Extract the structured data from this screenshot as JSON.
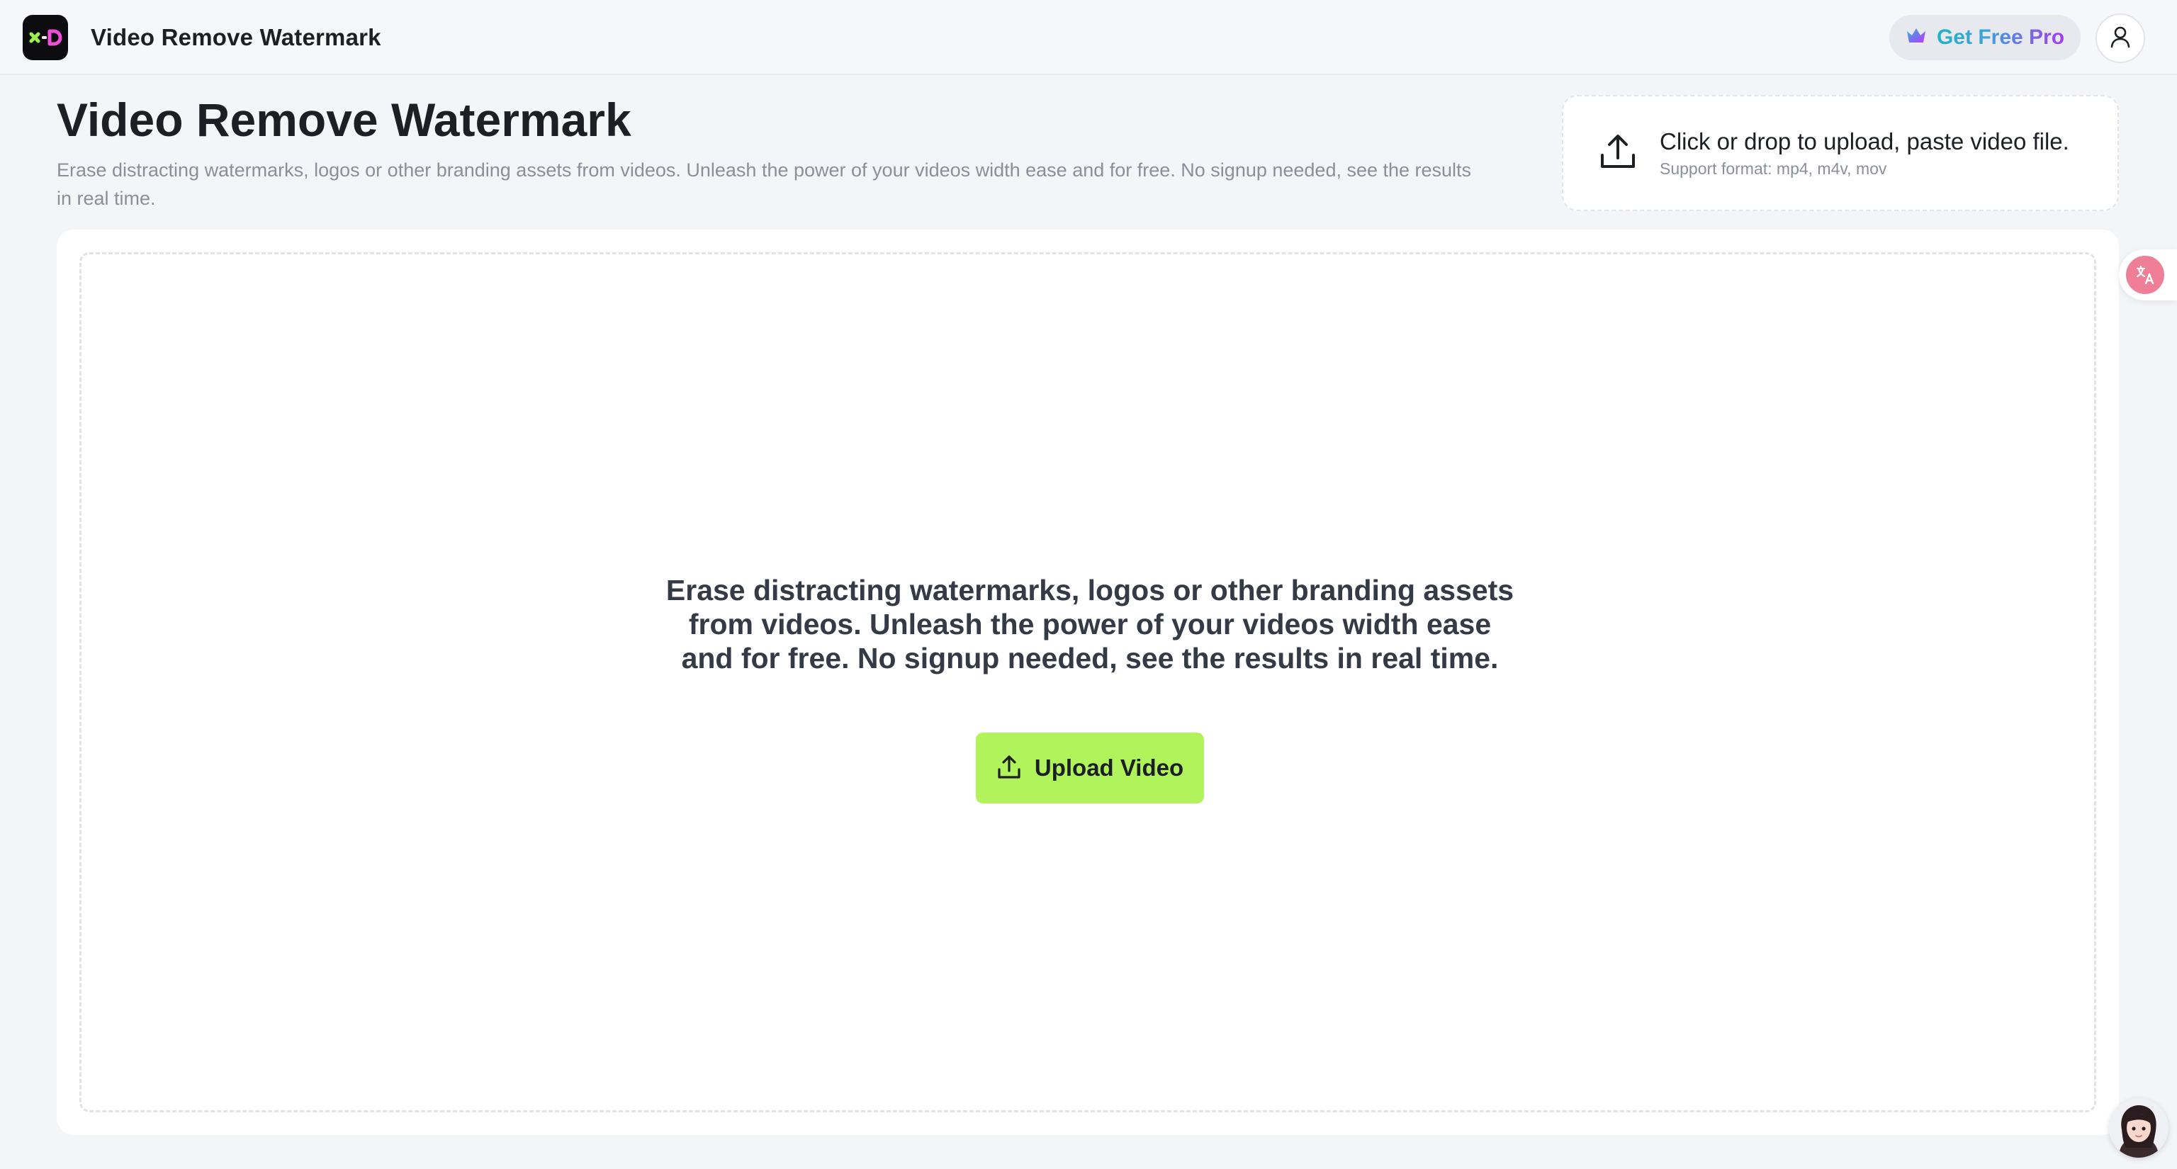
{
  "header": {
    "app_title": "Video Remove Watermark",
    "logo_icon": "x-d-logo",
    "get_pro_label": "Get Free Pro",
    "get_pro_icon": "crown-icon",
    "account_icon": "user-icon"
  },
  "hero": {
    "title": "Video Remove Watermark",
    "subtitle": "Erase distracting watermarks, logos or other branding assets from videos. Unleash the power of your videos width ease and for free. No signup needed, see the results in real time."
  },
  "upload_zone": {
    "icon": "upload-icon",
    "primary_text": "Click or drop to upload, paste video file.",
    "secondary_text": "Support format: mp4, m4v, mov"
  },
  "main": {
    "message": "Erase distracting watermarks, logos or other branding assets from videos. Unleash the power of your videos width ease and for free. No signup needed, see the results in real time.",
    "upload_button_label": "Upload Video",
    "upload_button_icon": "upload-icon"
  },
  "floating": {
    "translate_icon": "translate-icon",
    "assistant_icon": "assistant-avatar-icon"
  },
  "colors": {
    "accent_green": "#b1f35a",
    "logo_bg": "#0d0d0f",
    "logo_green": "#9cf04a",
    "logo_pink": "#f04dd8",
    "pro_gradient_start": "#22b3c2",
    "pro_gradient_end": "#a33cf0",
    "translate_pink": "#ee7f97",
    "page_bg": "#f4f5f7"
  }
}
